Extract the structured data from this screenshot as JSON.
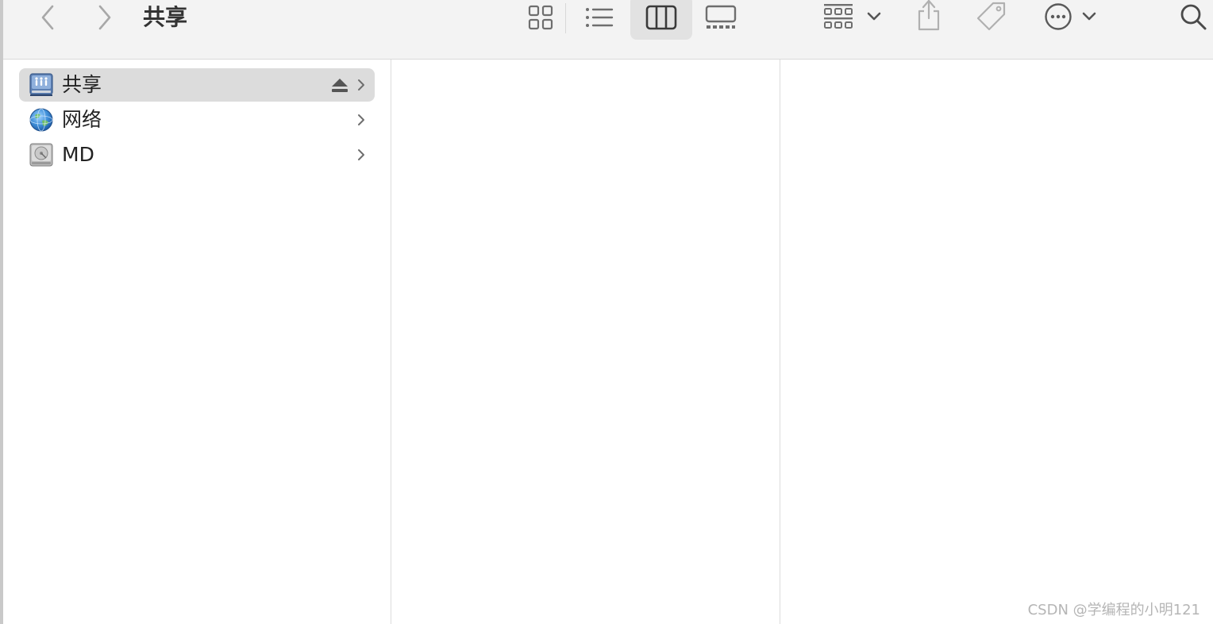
{
  "window": {
    "title": "共享"
  },
  "toolbar": {
    "icons": {
      "back": "chevron-left-icon",
      "forward": "chevron-right-icon",
      "view_icons": "grid-icon",
      "view_list": "list-icon",
      "view_columns": "columns-icon",
      "view_gallery": "gallery-icon",
      "group": "group-grid-icon",
      "share": "share-icon",
      "tag": "tag-icon",
      "more": "ellipsis-circle-icon",
      "search": "magnifier-icon"
    },
    "active_view": "columns"
  },
  "sidebar_column": {
    "items": [
      {
        "label": "共享",
        "icon": "shared-server-icon",
        "selected": true,
        "ejectable": true
      },
      {
        "label": "网络",
        "icon": "network-globe-icon",
        "selected": false,
        "ejectable": false
      },
      {
        "label": "MD",
        "icon": "hard-drive-icon",
        "selected": false,
        "ejectable": false
      }
    ]
  },
  "watermark": "CSDN @学编程的小明121",
  "colors": {
    "toolbar_bg": "#f3f3f3",
    "selection_bg": "#dcdcdc",
    "icon_gray": "#6e6e6e",
    "divider": "#dcdcdc"
  }
}
